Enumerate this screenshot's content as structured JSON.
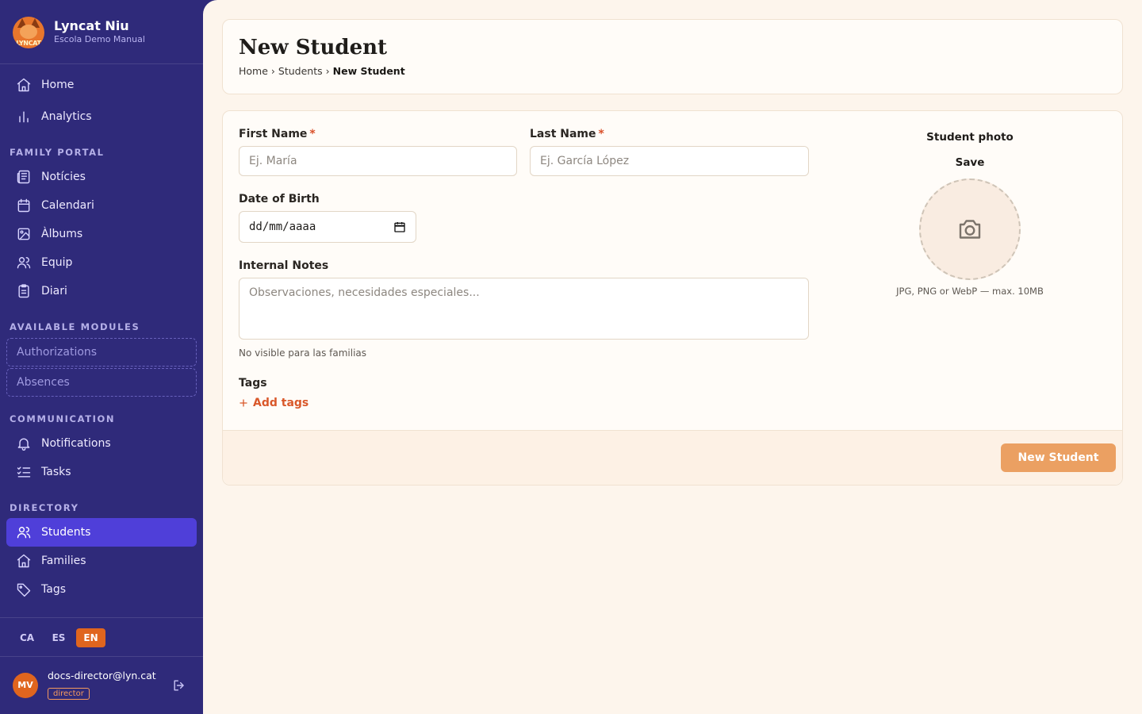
{
  "app": {
    "name": "Lyncat Niu",
    "school": "Escola Demo Manual",
    "logo_text": "LYNCAT"
  },
  "sidebar": {
    "main_items": [
      {
        "label": "Home",
        "icon": "home-icon"
      },
      {
        "label": "Analytics",
        "icon": "bar-chart-icon"
      }
    ],
    "sections": {
      "family_portal": "FAMILY PORTAL",
      "available_modules": "AVAILABLE MODULES",
      "communication": "COMMUNICATION",
      "directory": "DIRECTORY"
    },
    "family_portal_items": [
      {
        "label": "Notícies",
        "icon": "newspaper-icon"
      },
      {
        "label": "Calendari",
        "icon": "calendar-icon"
      },
      {
        "label": "Àlbums",
        "icon": "image-icon"
      },
      {
        "label": "Equip",
        "icon": "users-icon"
      },
      {
        "label": "Diari",
        "icon": "clipboard-icon"
      }
    ],
    "module_items": [
      {
        "label": "Authorizations"
      },
      {
        "label": "Absences"
      }
    ],
    "communication_items": [
      {
        "label": "Notifications",
        "icon": "bell-icon"
      },
      {
        "label": "Tasks",
        "icon": "checklist-icon"
      }
    ],
    "directory_items": [
      {
        "label": "Students",
        "icon": "users-icon",
        "active": true
      },
      {
        "label": "Families",
        "icon": "home-icon"
      },
      {
        "label": "Tags",
        "icon": "tag-icon"
      }
    ],
    "languages": [
      "CA",
      "ES",
      "EN"
    ],
    "active_language": "EN",
    "user": {
      "initials": "MV",
      "email": "docs-director@lyn.cat",
      "role": "director"
    }
  },
  "header": {
    "title": "New Student",
    "breadcrumb": {
      "home": "Home",
      "sep": "›",
      "students": "Students",
      "current": "New Student"
    }
  },
  "form": {
    "first_name": {
      "label": "First Name",
      "required_mark": "*",
      "placeholder": "Ej. María",
      "value": ""
    },
    "last_name": {
      "label": "Last Name",
      "required_mark": "*",
      "placeholder": "Ej. García López",
      "value": ""
    },
    "dob": {
      "label": "Date of Birth",
      "display": "dd/mm/aaaa"
    },
    "notes": {
      "label": "Internal Notes",
      "placeholder": "Observaciones, necesidades especiales...",
      "help": "No visible para las familias"
    },
    "tags": {
      "label": "Tags",
      "add_label": "Add tags"
    },
    "photo": {
      "title": "Student photo",
      "save_label": "Save",
      "hint": "JPG, PNG or WebP — max. 10MB"
    },
    "submit_label": "New Student"
  },
  "colors": {
    "sidebar_bg": "#2f2a7a",
    "active_nav": "#4f3fd9",
    "accent_orange": "#e0651e",
    "submit_btn": "#eba062",
    "page_bg": "#fdf5ec"
  }
}
